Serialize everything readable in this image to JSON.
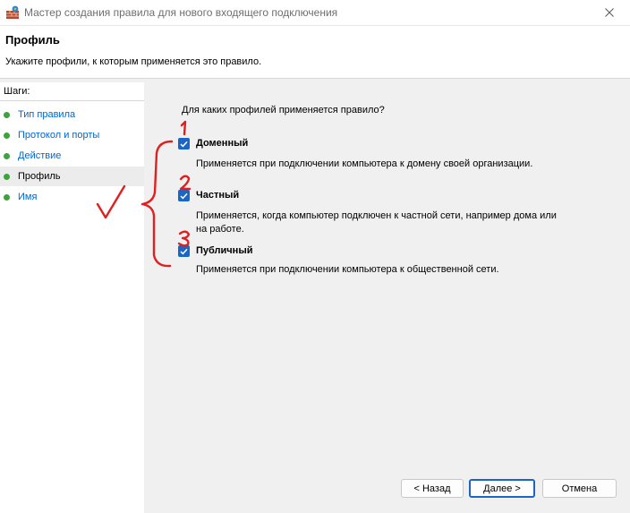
{
  "window": {
    "title": "Мастер создания правила для нового входящего подключения",
    "icon": "firewall-icon",
    "close_icon": "close-icon"
  },
  "header": {
    "title": "Профиль",
    "subtitle": "Укажите профили, к которым применяется это правило."
  },
  "sidebar": {
    "header": "Шаги:",
    "items": [
      {
        "label": "Тип правила",
        "active": false
      },
      {
        "label": "Протокол и порты",
        "active": false
      },
      {
        "label": "Действие",
        "active": false
      },
      {
        "label": "Профиль",
        "active": true
      },
      {
        "label": "Имя",
        "active": false
      }
    ]
  },
  "main": {
    "question": "Для каких профилей применяется правило?",
    "options": [
      {
        "label": "Доменный",
        "checked": true,
        "description": "Применяется при подключении компьютера к домену своей организации."
      },
      {
        "label": "Частный",
        "checked": true,
        "description": "Применяется, когда компьютер подключен к частной сети, например дома или на работе."
      },
      {
        "label": "Публичный",
        "checked": true,
        "description": "Применяется при подключении компьютера к общественной сети."
      }
    ]
  },
  "buttons": {
    "back": "< Назад",
    "next": "Далее >",
    "cancel": "Отмена"
  },
  "colors": {
    "accent": "#1a66c8",
    "step_dot": "#3ea33e",
    "annotation": "#e0201e"
  }
}
